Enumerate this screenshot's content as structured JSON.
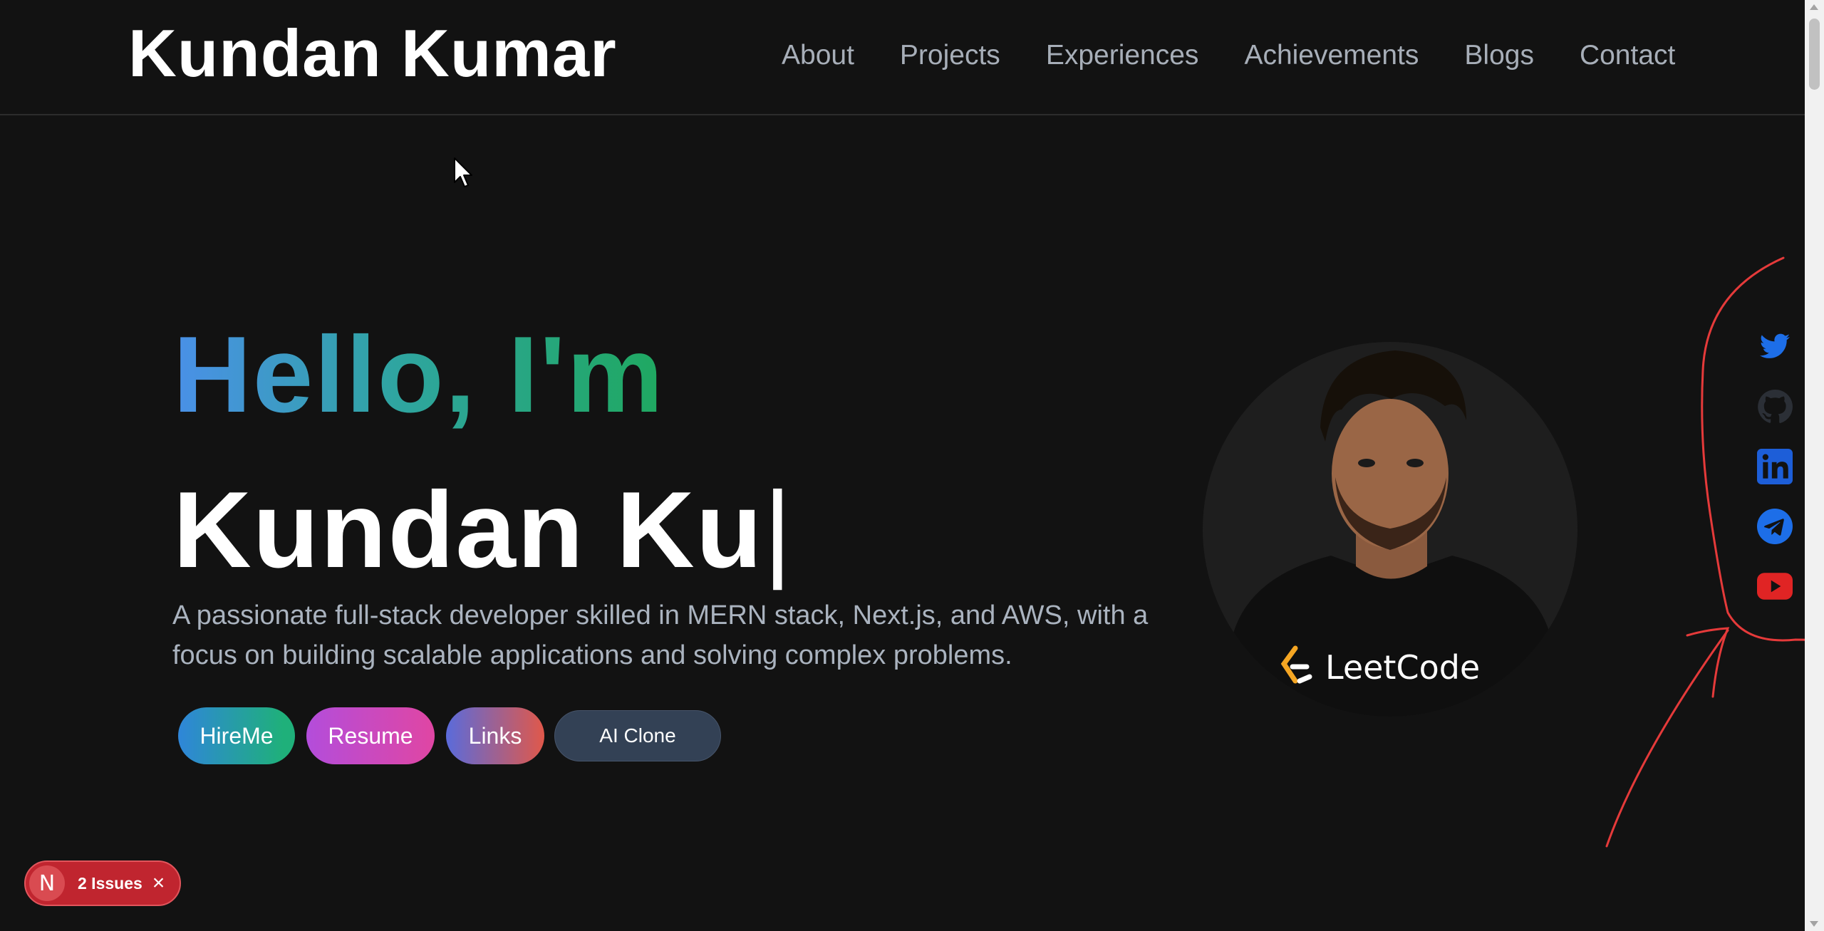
{
  "header": {
    "brand": "Kundan Kumar",
    "nav": [
      "About",
      "Projects",
      "Experiences",
      "Achievements",
      "Blogs",
      "Contact"
    ]
  },
  "hero": {
    "greeting": "Hello, I'm",
    "typed_name": "Kundan Ku",
    "caret": "|",
    "description": "A passionate full-stack developer skilled in MERN stack, Next.js, and AWS, with a focus on building scalable applications and solving complex problems.",
    "buttons": {
      "hire": "HireMe",
      "resume": "Resume",
      "links": "Links",
      "ai_clone": "AI Clone"
    }
  },
  "avatar": {
    "shirt_text": "LeetCode"
  },
  "social": [
    {
      "icon": "twitter-icon",
      "color": "#1d9bf0"
    },
    {
      "icon": "github-icon",
      "color": "#2b2f36"
    },
    {
      "icon": "linkedin-icon",
      "color": "#0a66c2"
    },
    {
      "icon": "telegram-icon",
      "color": "#2a6ee8"
    },
    {
      "icon": "youtube-icon",
      "color": "#e02424"
    }
  ],
  "dev_overlay": {
    "logo": "N",
    "issues_label": "2 Issues",
    "close": "×"
  },
  "colors": {
    "background": "#121212",
    "nav_text": "#a7aeb8",
    "annotation": "#e53a3a"
  }
}
